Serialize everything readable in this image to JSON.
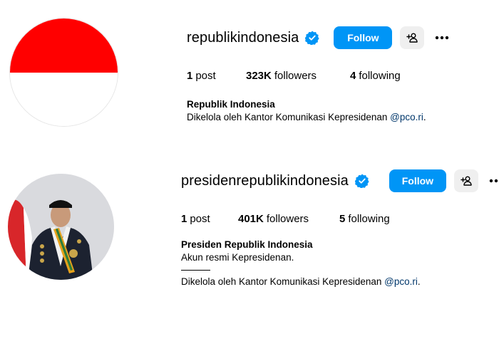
{
  "profiles": [
    {
      "username": "republikindonesia",
      "verified_color": "#0095f6",
      "follow_label": "Follow",
      "posts_count": "1",
      "posts_label": "post",
      "followers_count": "323K",
      "followers_label": "followers",
      "following_count": "4",
      "following_label": "following",
      "bio_name": "Republik Indonesia",
      "bio_text": "Dikelola oleh Kantor Komunikasi Kepresidenan ",
      "bio_mention": "@pco.ri",
      "bio_end": ".",
      "avatar_colors": [
        "#ff0000",
        "#ffffff"
      ]
    },
    {
      "username": "presidenrepublikindonesia",
      "verified_color": "#0095f6",
      "follow_label": "Follow",
      "posts_count": "1",
      "posts_label": "post",
      "followers_count": "401K",
      "followers_label": "followers",
      "following_count": "5",
      "following_label": "following",
      "bio_name": "Presiden Republik Indonesia",
      "bio_line2": "Akun resmi Kepresidenan.",
      "bio_text": "Dikelola oleh Kantor Komunikasi Kepresidenan ",
      "bio_mention": "@pco.ri",
      "bio_end": "."
    }
  ],
  "icons": {
    "verified": "verified-badge-icon",
    "add_person": "add-person-icon",
    "more": "more-options-icon"
  },
  "colors": {
    "accent": "#0095f6",
    "link": "#00376b",
    "secondary_button": "#efefef"
  }
}
